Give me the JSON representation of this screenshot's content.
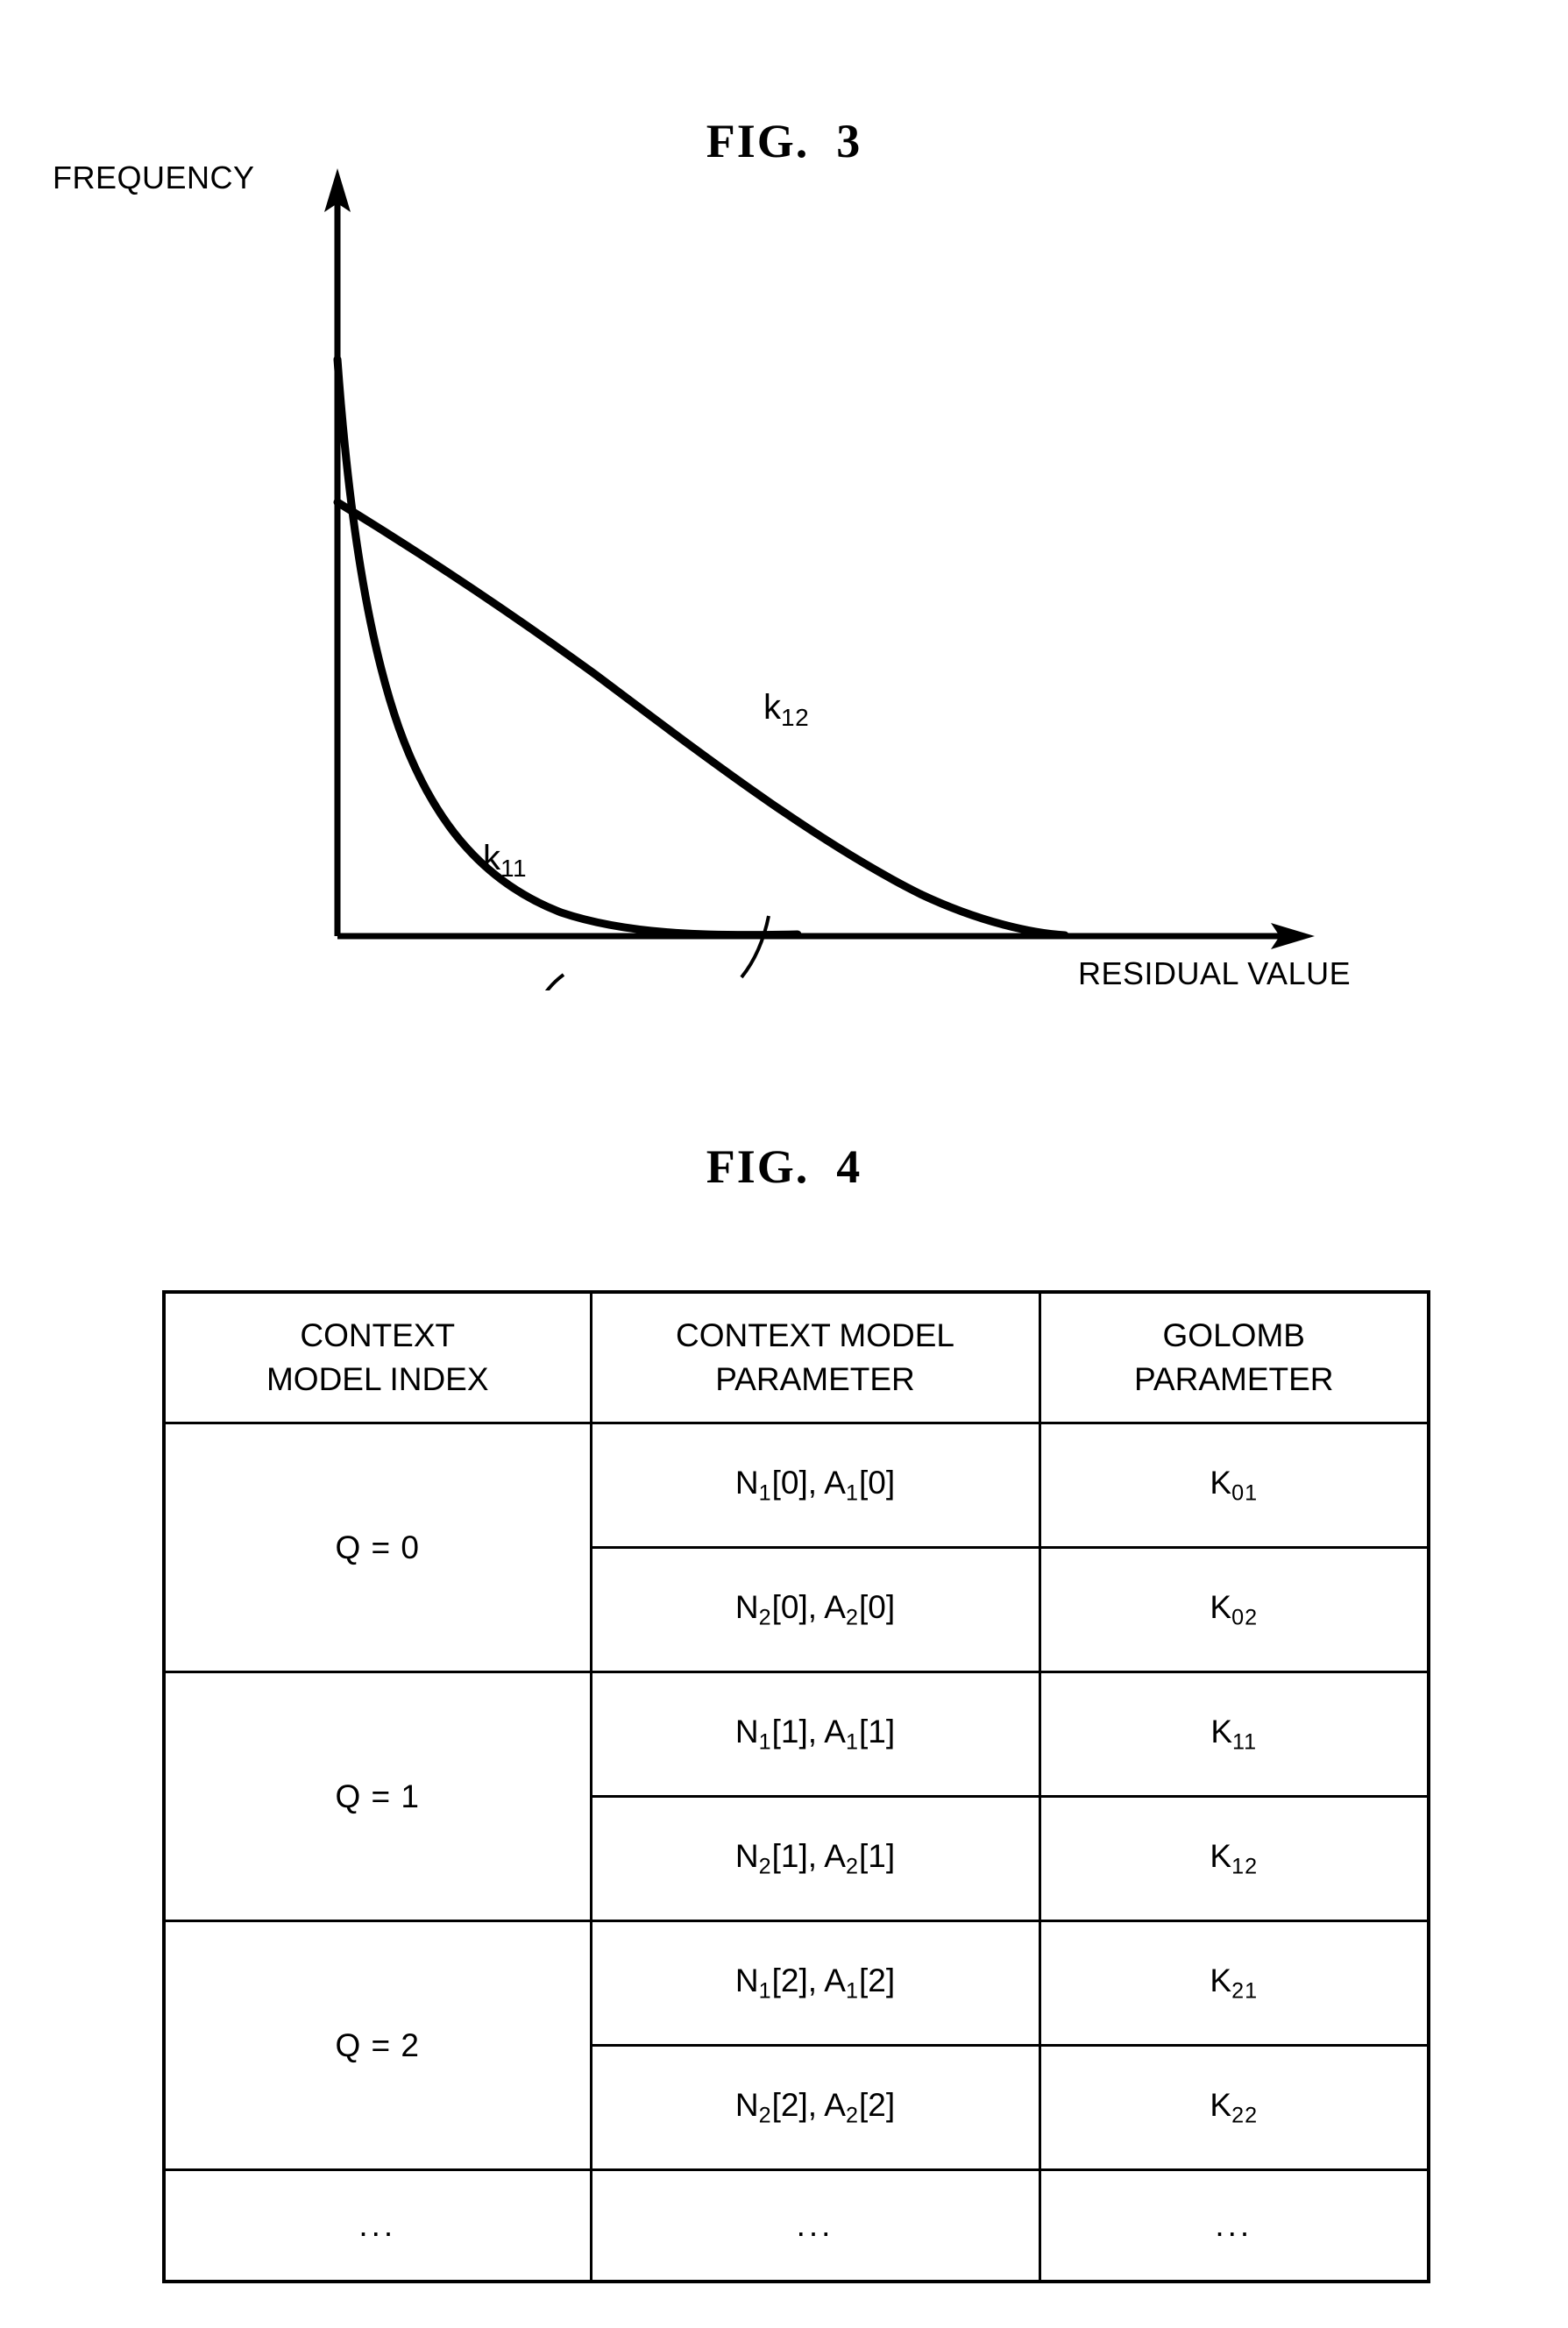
{
  "figures": [
    {
      "id": "fig3",
      "title": "FIG.  3",
      "type": "line-plot",
      "y_axis_label": "FREQUENCY",
      "x_axis_label": "RESIDUAL VALUE",
      "curve_labels": [
        {
          "base": "k",
          "sub": "11"
        },
        {
          "base": "k",
          "sub": "12"
        }
      ]
    },
    {
      "id": "fig4",
      "title": "FIG.  4",
      "type": "table",
      "headers": [
        "CONTEXT\nMODEL INDEX",
        "CONTEXT MODEL\nPARAMETER",
        "GOLOMB\nPARAMETER"
      ],
      "groups": [
        {
          "index": "Q = 0",
          "rows": [
            {
              "param_n": "N",
              "param_n_sub": "1",
              "param_n_idx": "[0]",
              "param_a": "A",
              "param_a_sub": "1",
              "param_a_idx": "[0]",
              "golomb": "K",
              "golomb_sub": "01"
            },
            {
              "param_n": "N",
              "param_n_sub": "2",
              "param_n_idx": "[0]",
              "param_a": "A",
              "param_a_sub": "2",
              "param_a_idx": "[0]",
              "golomb": "K",
              "golomb_sub": "02"
            }
          ]
        },
        {
          "index": "Q = 1",
          "rows": [
            {
              "param_n": "N",
              "param_n_sub": "1",
              "param_n_idx": "[1]",
              "param_a": "A",
              "param_a_sub": "1",
              "param_a_idx": "[1]",
              "golomb": "K",
              "golomb_sub": "11"
            },
            {
              "param_n": "N",
              "param_n_sub": "2",
              "param_n_idx": "[1]",
              "param_a": "A",
              "param_a_sub": "2",
              "param_a_idx": "[1]",
              "golomb": "K",
              "golomb_sub": "12"
            }
          ]
        },
        {
          "index": "Q = 2",
          "rows": [
            {
              "param_n": "N",
              "param_n_sub": "1",
              "param_n_idx": "[2]",
              "param_a": "A",
              "param_a_sub": "1",
              "param_a_idx": "[2]",
              "golomb": "K",
              "golomb_sub": "21"
            },
            {
              "param_n": "N",
              "param_n_sub": "2",
              "param_n_idx": "[2]",
              "param_a": "A",
              "param_a_sub": "2",
              "param_a_idx": "[2]",
              "golomb": "K",
              "golomb_sub": "22"
            }
          ]
        }
      ],
      "ellipsis_row": [
        "...",
        "...",
        "..."
      ]
    }
  ],
  "chart_data": {
    "type": "line",
    "title": "FIG.  3",
    "xlabel": "RESIDUAL VALUE",
    "ylabel": "FREQUENCY",
    "grid": false,
    "legend": "inline-annotations",
    "axis_arrows": true,
    "tick_labels": {
      "x": [],
      "y": []
    },
    "xlim": [
      0,
      1
    ],
    "ylim": [
      0,
      1
    ],
    "description": "Two monotonically decreasing frequency distributions of residual values; the steeper curve k11 decays fast from a high peak, the flatter curve k12 starts lower and decays slowly, the two crossing near the left of the plot.",
    "series": [
      {
        "name": "k11",
        "label_base": "k",
        "label_sub": "11",
        "x": [
          0.0,
          0.05,
          0.1,
          0.15,
          0.2,
          0.25,
          0.3,
          0.35,
          0.4,
          0.45,
          0.5,
          0.55,
          0.6,
          0.65,
          0.7
        ],
        "y": [
          1.0,
          0.72,
          0.52,
          0.375,
          0.27,
          0.195,
          0.14,
          0.1,
          0.072,
          0.052,
          0.037,
          0.027,
          0.019,
          0.012,
          0.004
        ]
      },
      {
        "name": "k12",
        "label_base": "k",
        "label_sub": "12",
        "x": [
          0.0,
          0.1,
          0.2,
          0.3,
          0.4,
          0.5,
          0.6,
          0.7,
          0.8,
          0.9,
          1.0
        ],
        "y": [
          0.805,
          0.715,
          0.625,
          0.533,
          0.44,
          0.345,
          0.25,
          0.16,
          0.082,
          0.025,
          0.0
        ]
      }
    ]
  }
}
